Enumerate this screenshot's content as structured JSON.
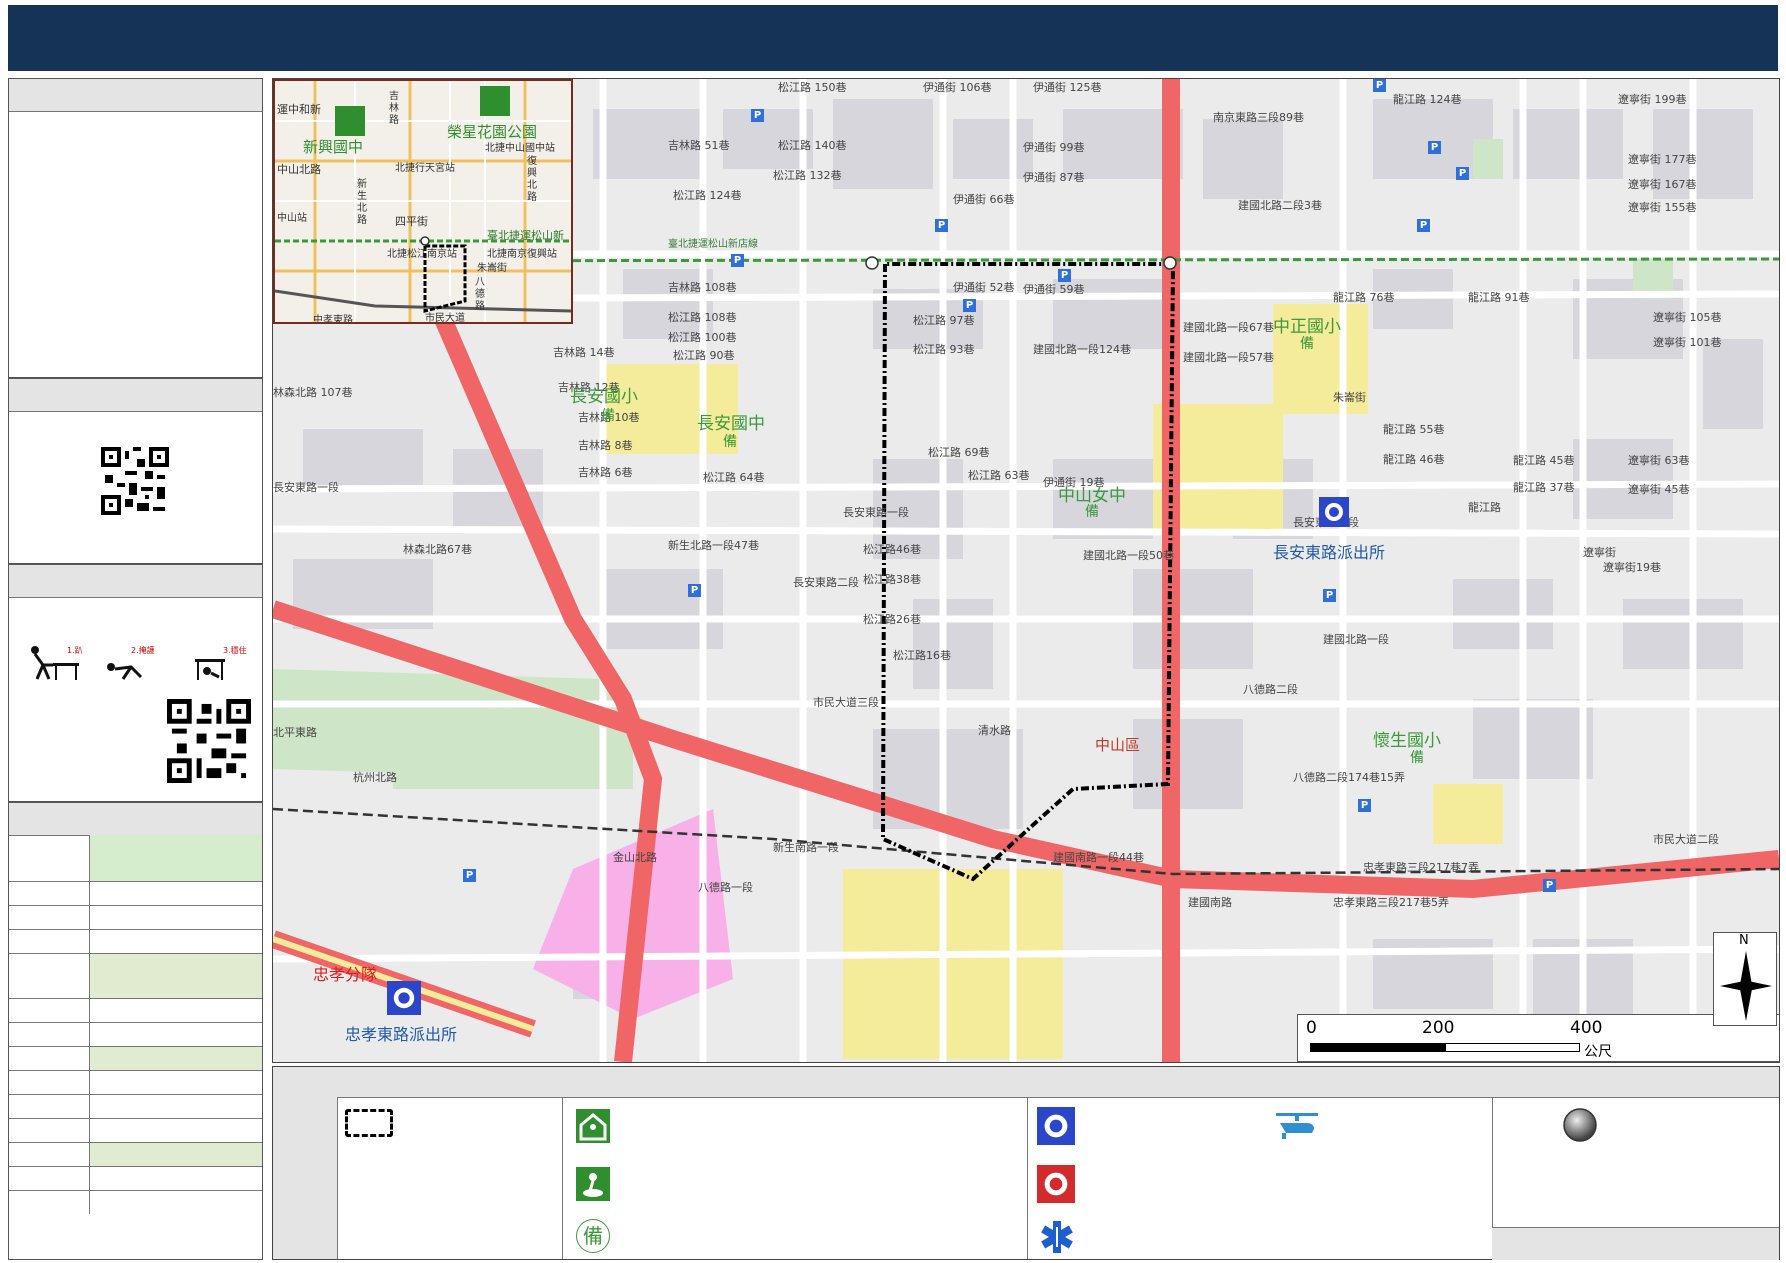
{
  "colors": {
    "header": "#143357",
    "main_road": "#f06666",
    "park": "#cfe5c7",
    "school": "#f4ec9a",
    "hospital": "#f7b0e8"
  },
  "map": {
    "labels": [
      {
        "id": "l1",
        "t": "松江路 150巷"
      },
      {
        "id": "l2",
        "t": "伊通街 106巷"
      },
      {
        "id": "l3",
        "t": "伊通街 125巷"
      },
      {
        "id": "l4",
        "t": "南京東路三段89巷"
      },
      {
        "id": "l5",
        "t": "龍江路 124巷"
      },
      {
        "id": "l6",
        "t": "遼寧街 199巷"
      },
      {
        "id": "l7",
        "t": "松江路 140巷"
      },
      {
        "id": "l8",
        "t": "伊通街 99巷"
      },
      {
        "id": "l9",
        "t": "伊通街 87巷"
      },
      {
        "id": "l10",
        "t": "吉林路 51巷"
      },
      {
        "id": "l11",
        "t": "松江路 132巷"
      },
      {
        "id": "l12",
        "t": "伊通街 66巷"
      },
      {
        "id": "l13",
        "t": "建國北路二段3巷"
      },
      {
        "id": "l14",
        "t": "遼寧街 177巷"
      },
      {
        "id": "l15",
        "t": "遼寧街 167巷"
      },
      {
        "id": "l16",
        "t": "遼寧街 155巷"
      },
      {
        "id": "l17",
        "t": "松江路 124巷"
      },
      {
        "id": "l18",
        "t": "吉林路 108巷"
      },
      {
        "id": "l19",
        "t": "松江路 108巷"
      },
      {
        "id": "l20",
        "t": "伊通街 52巷"
      },
      {
        "id": "l21",
        "t": "伊通街 59巷"
      },
      {
        "id": "l22",
        "t": "龍江路 76巷"
      },
      {
        "id": "l23",
        "t": "龍江路 91巷"
      },
      {
        "id": "l24",
        "t": "松江路 100巷"
      },
      {
        "id": "l25",
        "t": "松江路 97巷"
      },
      {
        "id": "l26",
        "t": "建國北路一段67巷"
      },
      {
        "id": "l27",
        "t": "吉林路 14巷"
      },
      {
        "id": "l28",
        "t": "松江路 90巷"
      },
      {
        "id": "l29",
        "t": "松江路 93巷"
      },
      {
        "id": "l30",
        "t": "建國北路一段124巷"
      },
      {
        "id": "l31",
        "t": "建國北路一段57巷"
      },
      {
        "id": "l32",
        "t": "遼寧街 105巷"
      },
      {
        "id": "l33",
        "t": "遼寧街 101巷"
      },
      {
        "id": "l34",
        "t": "吉林路 12巷"
      },
      {
        "id": "l35",
        "t": "吉林路 10巷"
      },
      {
        "id": "l36",
        "t": "吉林路 8巷"
      },
      {
        "id": "l37",
        "t": "吉林路 6巷"
      },
      {
        "id": "l38",
        "t": "松江路 69巷"
      },
      {
        "id": "l39",
        "t": "松江路 63巷"
      },
      {
        "id": "l40",
        "t": "松江路 64巷"
      },
      {
        "id": "l41",
        "t": "伊通街 19巷"
      },
      {
        "id": "l42",
        "t": "龍江路 55巷"
      },
      {
        "id": "l43",
        "t": "龍江路 46巷"
      },
      {
        "id": "l44",
        "t": "龍江路 45巷"
      },
      {
        "id": "l45",
        "t": "龍江路 37巷"
      },
      {
        "id": "l46",
        "t": "遼寧街 63巷"
      },
      {
        "id": "l47",
        "t": "遼寧街 45巷"
      },
      {
        "id": "l48",
        "t": "長安東路二段"
      },
      {
        "id": "l49",
        "t": "長安東路一段"
      },
      {
        "id": "l50",
        "t": "新生北路一段47巷"
      },
      {
        "id": "l51",
        "t": "松江路46巷"
      },
      {
        "id": "l52",
        "t": "松江路38巷"
      },
      {
        "id": "l53",
        "t": "松江路26巷"
      },
      {
        "id": "l54",
        "t": "松江路16巷"
      },
      {
        "id": "l55",
        "t": "建國北路一段50巷"
      },
      {
        "id": "l56",
        "t": "遼寧街19巷"
      },
      {
        "id": "l57",
        "t": "林森北路67巷"
      },
      {
        "id": "l58",
        "t": "建國北路一段"
      },
      {
        "id": "l59",
        "t": "八德路二段"
      },
      {
        "id": "l60",
        "t": "清水路"
      },
      {
        "id": "l61",
        "t": "市民大道三段"
      },
      {
        "id": "l62",
        "t": "市民大道二段"
      },
      {
        "id": "l63",
        "t": "北平東路"
      },
      {
        "id": "l64",
        "t": "八德路一段"
      },
      {
        "id": "l65",
        "t": "八德路二段174巷15弄"
      },
      {
        "id": "l66",
        "t": "建國南路一段44巷"
      },
      {
        "id": "l67",
        "t": "忠孝東路三段217巷7弄"
      },
      {
        "id": "l68",
        "t": "忠孝東路三段217巷5弄"
      },
      {
        "id": "l69",
        "t": "建國南路"
      },
      {
        "id": "l70",
        "t": "林森北路 107巷"
      },
      {
        "id": "l71",
        "t": "長安東路二段"
      },
      {
        "id": "l72",
        "t": "長安東路一段"
      },
      {
        "id": "l73",
        "t": "朱崙街"
      },
      {
        "id": "l74",
        "t": "遼寧街"
      },
      {
        "id": "l75",
        "t": "龍江路"
      },
      {
        "id": "l76",
        "t": "杭州北路"
      },
      {
        "id": "l77",
        "t": "新生南路一段"
      },
      {
        "id": "l78",
        "t": "金山北路"
      }
    ],
    "pois_green": [
      {
        "id": "g1",
        "t": "長安國小"
      },
      {
        "id": "g2",
        "t": "長安國中"
      },
      {
        "id": "g3",
        "t": "中山女中"
      },
      {
        "id": "g4",
        "t": "中正國小"
      },
      {
        "id": "g5",
        "t": "懷生國小"
      }
    ],
    "pois_blue": [
      {
        "id": "b1",
        "t": "長安東路派出所"
      },
      {
        "id": "b2",
        "t": "忠孝東路派出所"
      }
    ],
    "poi_red": "忠孝分隊",
    "district": "中山區",
    "mrt": "臺北捷運松山新店線",
    "bei_glyph": "備",
    "north": "N",
    "scale": {
      "ticks": [
        "0",
        "200",
        "400"
      ],
      "unit": "公尺"
    }
  },
  "inset": {
    "labels": [
      {
        "id": "i1",
        "t": "運中和新",
        "big": false
      },
      {
        "id": "i2",
        "t": "新興國中",
        "big": true,
        "green": true
      },
      {
        "id": "i3",
        "t": "榮星花園公園",
        "big": true,
        "green": true
      },
      {
        "id": "i4",
        "t": "北捷中山國中站",
        "big": false
      },
      {
        "id": "i5",
        "t": "北捷行天宮站",
        "big": false
      },
      {
        "id": "i6",
        "t": "中山北路",
        "big": false
      },
      {
        "id": "i7",
        "t": "吉林路",
        "big": false
      },
      {
        "id": "i8",
        "t": "復興北路",
        "big": false
      },
      {
        "id": "i9",
        "t": "新生北路",
        "big": false
      },
      {
        "id": "i10",
        "t": "四平街",
        "big": false
      },
      {
        "id": "i11",
        "t": "臺北捷運松山新",
        "big": false
      },
      {
        "id": "i12",
        "t": "北捷松江南京站",
        "big": false
      },
      {
        "id": "i13",
        "t": "北捷南京復興站",
        "big": false
      },
      {
        "id": "i14",
        "t": "朱崙街",
        "big": false
      },
      {
        "id": "i15",
        "t": "八德路",
        "big": false
      },
      {
        "id": "i16",
        "t": "市民大道",
        "big": false
      },
      {
        "id": "i17",
        "t": "中山站",
        "big": false
      },
      {
        "id": "i18",
        "t": "中孝東路",
        "big": false
      }
    ]
  },
  "legend": {
    "helicopter_icon": "helicopter-icon",
    "police_icon": "police-badge-icon",
    "fire_icon": "fire-badge-icon",
    "medical_icon": "star-of-life-icon",
    "shelter_icon": "shelter-icon",
    "park_icon": "park-icon",
    "bei_glyph": "備"
  },
  "sidebar": {
    "earthquake_icons": [
      "1.趴下",
      "2.掩護",
      "3.穩住"
    ]
  }
}
